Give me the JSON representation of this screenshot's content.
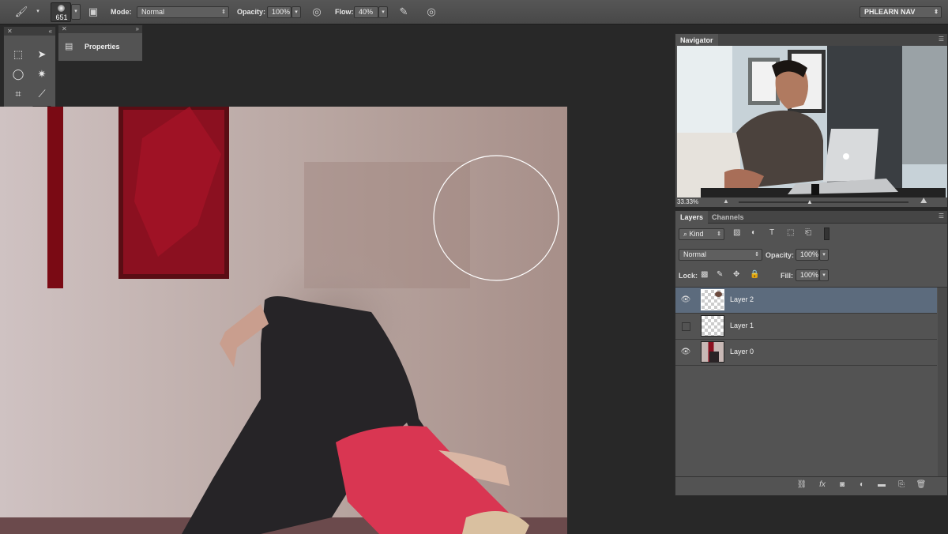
{
  "options_bar": {
    "brush_size": "651",
    "mode_label": "Mode:",
    "mode_value": "Normal",
    "opacity_label": "Opacity:",
    "opacity_value": "100%",
    "flow_label": "Flow:",
    "flow_value": "40%",
    "workspace": "PHLEARN NAV"
  },
  "properties_panel": {
    "title": "Properties"
  },
  "navigator": {
    "title": "Navigator",
    "zoom": "33.33%"
  },
  "layers_panel": {
    "tabs": [
      "Layers",
      "Channels"
    ],
    "filter_kind": "Kind",
    "blend_mode": "Normal",
    "opacity_label": "Opacity:",
    "opacity_value": "100%",
    "lock_label": "Lock:",
    "fill_label": "Fill:",
    "fill_value": "100%",
    "layers": [
      {
        "name": "Layer 2",
        "visible": true,
        "selected": true
      },
      {
        "name": "Layer 1",
        "visible": false,
        "selected": false
      },
      {
        "name": "Layer 0",
        "visible": true,
        "selected": false
      }
    ]
  },
  "colors": {
    "foreground": "#7d6358",
    "background": "#000000",
    "selected_layer": "#5c6b7d"
  }
}
